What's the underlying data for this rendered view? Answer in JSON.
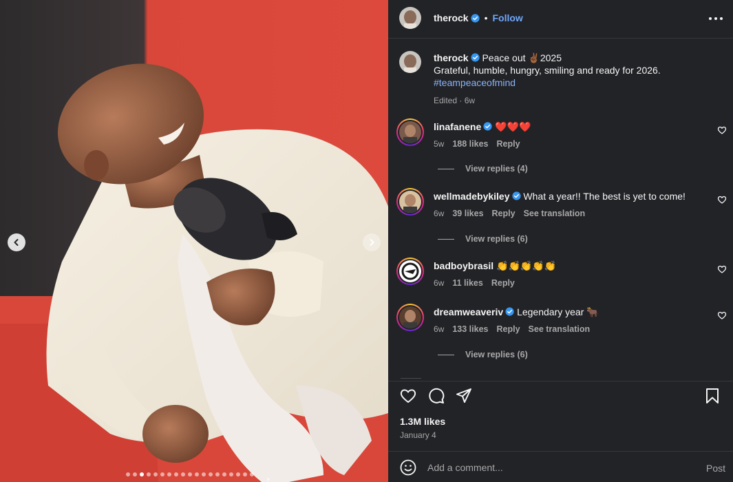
{
  "post": {
    "username": "therock",
    "follow_label": "Follow",
    "caption_title": "Peace out ✌🏾2025",
    "caption_line2": "Grateful, humble, hungry, smiling and ready for 2026.",
    "caption_hashtag": "#teampeaceofmind",
    "caption_meta": "Edited · 6w",
    "likes": "1.3M likes",
    "date": "January 4"
  },
  "media": {
    "carousel_total": 19,
    "carousel_active_index": 2
  },
  "comments": [
    {
      "username": "linafanene",
      "verified": true,
      "text": "❤️❤️❤️",
      "age": "5w",
      "likes": "188 likes",
      "reply": "Reply",
      "translate": "",
      "replies": "View replies (4)"
    },
    {
      "username": "wellmadebykiley",
      "verified": true,
      "text": "What a year!! The best is yet to come!",
      "age": "6w",
      "likes": "39 likes",
      "reply": "Reply",
      "translate": "See translation",
      "replies": "View replies (6)"
    },
    {
      "username": "badboybrasil",
      "verified": false,
      "text": "👏👏👏👏👏",
      "age": "6w",
      "likes": "11 likes",
      "reply": "Reply",
      "translate": "",
      "replies": ""
    },
    {
      "username": "dreamweaveriv",
      "verified": true,
      "text": "Legendary year 🐂",
      "age": "6w",
      "likes": "133 likes",
      "reply": "Reply",
      "translate": "See translation",
      "replies": "View replies (6)"
    }
  ],
  "composer": {
    "placeholder": "Add a comment...",
    "post_label": "Post"
  },
  "colors": {
    "panel_bg": "#222327",
    "link_blue": "#6ea8fe",
    "hashtag_blue": "#8ab4f8",
    "photo_red": "#d64136"
  },
  "icons": [
    "verified-badge-icon",
    "more-options-icon",
    "heart-icon",
    "comment-icon",
    "share-icon",
    "bookmark-icon",
    "emoji-icon",
    "chevron-left-icon",
    "chevron-right-icon"
  ]
}
